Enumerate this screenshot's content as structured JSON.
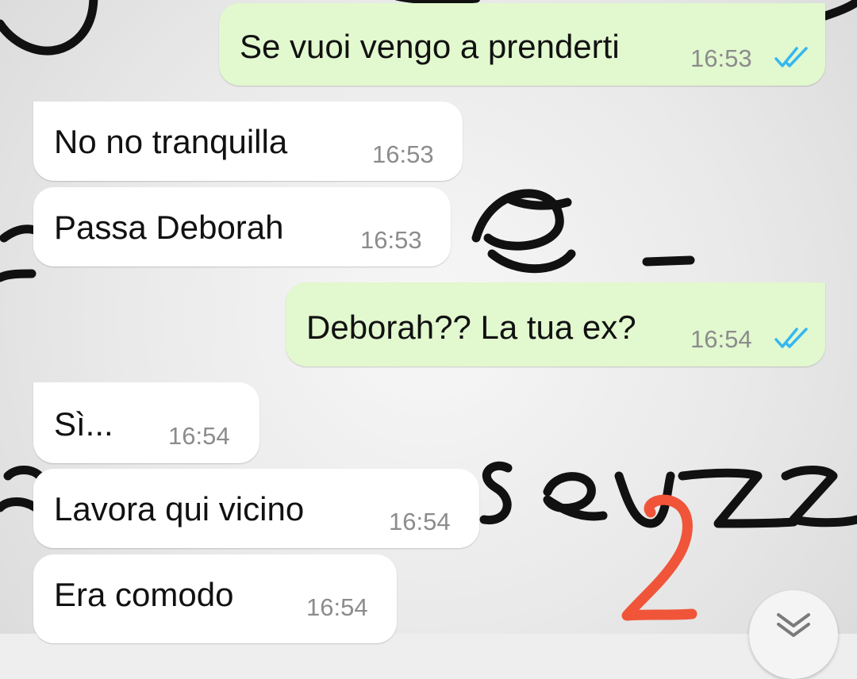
{
  "conversation": {
    "messages": [
      {
        "direction": "outgoing",
        "text": "Se vuoi vengo a prenderti",
        "time": "16:53",
        "status": "read"
      },
      {
        "direction": "incoming",
        "text": "No no tranquilla",
        "time": "16:53"
      },
      {
        "direction": "incoming",
        "text": "Passa Deborah",
        "time": "16:53"
      },
      {
        "direction": "outgoing",
        "text": "Deborah?? La tua ex?",
        "time": "16:54",
        "status": "read"
      },
      {
        "direction": "incoming",
        "text": "Sì...",
        "time": "16:54"
      },
      {
        "direction": "incoming",
        "text": "Lavora qui vicino",
        "time": "16:54"
      },
      {
        "direction": "incoming",
        "text": "Era comodo",
        "time": "16:54"
      }
    ]
  },
  "overlay": {
    "annotation_text": "2",
    "annotation_color": "#f0553a"
  },
  "controls": {
    "scroll_down_icon": "double-chevron-down-icon"
  },
  "colors": {
    "outgoing_bubble": "#e2f8cf",
    "incoming_bubble": "#ffffff",
    "read_tick": "#34b7f1",
    "timestamp": "#8c8c8c"
  }
}
